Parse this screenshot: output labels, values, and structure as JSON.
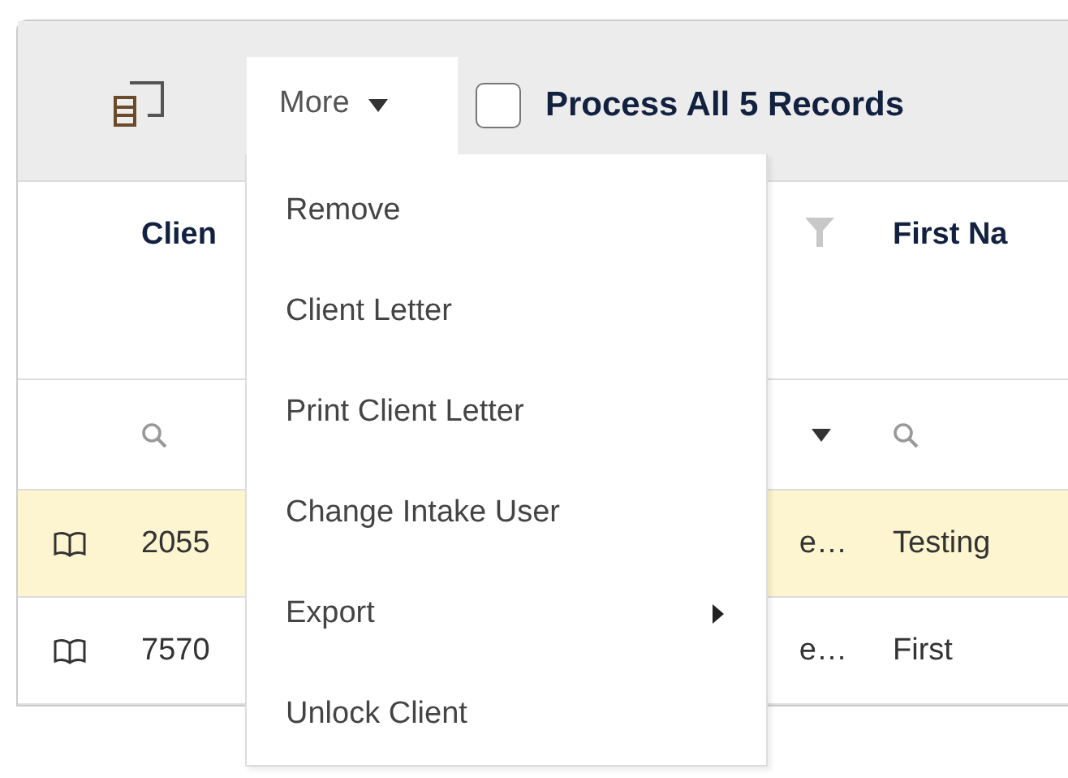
{
  "toolbar": {
    "more_button": {
      "label": "More",
      "expanded": true
    },
    "process_all": {
      "label": "Process All 5 Records",
      "checked": false
    }
  },
  "more_menu": {
    "items": [
      {
        "label": "Remove",
        "kind": "item"
      },
      {
        "label": "Client Letter",
        "kind": "item"
      },
      {
        "label": "Print Client Letter",
        "kind": "item"
      },
      {
        "label": "Change Intake User",
        "kind": "item"
      },
      {
        "label": "Export",
        "kind": "submenu"
      },
      {
        "label": "Unlock Client",
        "kind": "item"
      }
    ]
  },
  "table": {
    "columns": [
      {
        "label": "Clien",
        "kind": "text"
      },
      {
        "kind": "funnel"
      },
      {
        "label": "First Na",
        "kind": "text"
      }
    ],
    "filter_row": [
      {
        "kind": "search"
      },
      {
        "kind": "dropdown"
      },
      {
        "kind": "search"
      }
    ],
    "rows": [
      {
        "selected": true,
        "cells": [
          "2055",
          "e…",
          "Testing"
        ]
      },
      {
        "selected": false,
        "cells": [
          "7570",
          "e…",
          "First"
        ]
      }
    ]
  }
}
